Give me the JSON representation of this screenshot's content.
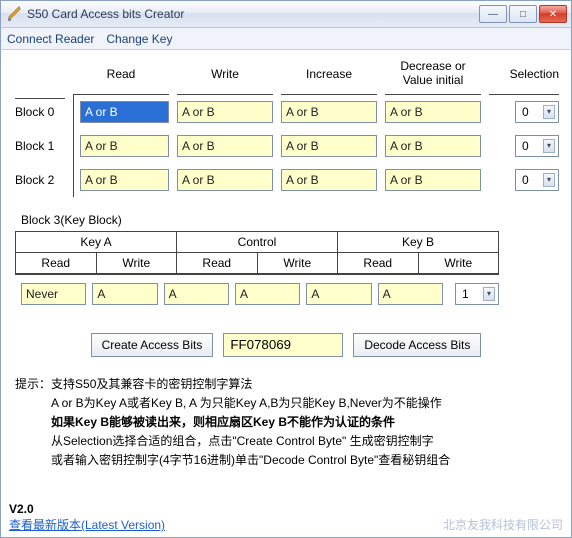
{
  "window": {
    "title": "S50 Card Access bits Creator",
    "min": "—",
    "max": "□",
    "close": "✕"
  },
  "menu": {
    "connect": "Connect Reader",
    "changekey": "Change Key"
  },
  "headers": {
    "read": "Read",
    "write": "Write",
    "increase": "Increase",
    "decr": "Decrease or\nValue initial",
    "selection": "Selection"
  },
  "blocks": [
    {
      "label": "Block 0",
      "read": "A or B",
      "write": "A or B",
      "increase": "A or B",
      "decr": "A or B",
      "sel": "0"
    },
    {
      "label": "Block 1",
      "read": "A or B",
      "write": "A or B",
      "increase": "A or B",
      "decr": "A or B",
      "sel": "0"
    },
    {
      "label": "Block 2",
      "read": "A or B",
      "write": "A or B",
      "increase": "A or B",
      "decr": "A or B",
      "sel": "0"
    }
  ],
  "block3": {
    "label": "Block 3(Key Block)",
    "groups": {
      "keya": "Key A",
      "control": "Control",
      "keyb": "Key B"
    },
    "sub": {
      "read": "Read",
      "write": "Write"
    },
    "row": {
      "keya_r": "Never",
      "keya_w": "A",
      "ctrl_r": "A",
      "ctrl_w": "A",
      "keyb_r": "A",
      "keyb_w": "A",
      "sel": "1"
    }
  },
  "actions": {
    "create": "Create Access Bits",
    "result": "FF078069",
    "decode": "Decode Access Bits"
  },
  "hints": {
    "l1_label": "提示：",
    "l1": "支持S50及其兼容卡的密钥控制字算法",
    "l2": "A or B为Key A或者Key B, A 为只能Key A,B为只能Key B,Never为不能操作",
    "l3": "如果Key B能够被读出来，则相应扇区Key B不能作为认证的条件",
    "l4": "从Selection选择合适的组合，点击\"Create Control Byte\" 生成密钥控制字",
    "l5": "或者输入密钥控制字(4字节16进制)单击\"Decode Control Byte\"查看秘钥组合"
  },
  "footer": {
    "version": "V2.0",
    "latest": "查看最新版本(Latest Version)",
    "company": "北京友我科技有限公司"
  }
}
